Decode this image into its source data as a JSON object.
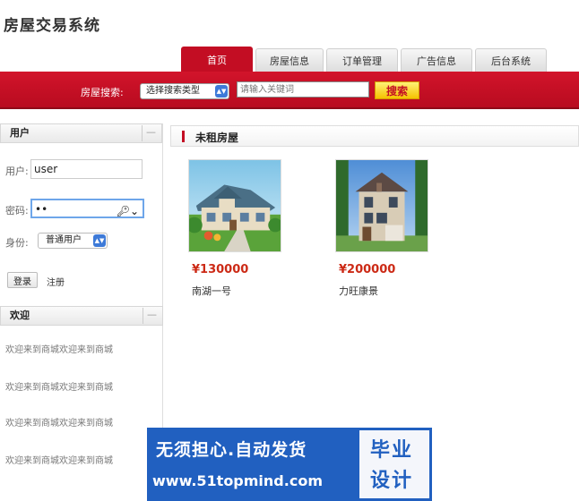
{
  "app": {
    "title": "房屋交易系统"
  },
  "nav": {
    "tabs": [
      {
        "label": "首页",
        "active": true
      },
      {
        "label": "房屋信息",
        "active": false
      },
      {
        "label": "订单管理",
        "active": false
      },
      {
        "label": "广告信息",
        "active": false
      },
      {
        "label": "后台系统",
        "active": false
      }
    ]
  },
  "search": {
    "label": "房屋搜索:",
    "type_select": "选择搜索类型",
    "placeholder": "请输入关键词",
    "button_label": "搜索"
  },
  "sidebar": {
    "user_panel": {
      "title": "用户",
      "collapse": "—",
      "username_label": "用户:",
      "username_value": "user",
      "password_label": "密码:",
      "password_value": "••",
      "role_label": "身份:",
      "role_value": "普通用户",
      "login_button": "登录",
      "register_link": "注册"
    },
    "welcome_panel": {
      "title": "欢迎",
      "collapse": "—",
      "lines": [
        "欢迎来到商城欢迎来到商城",
        "欢迎来到商城欢迎来到商城",
        "欢迎来到商城欢迎来到商城",
        "欢迎来到商城欢迎来到商城"
      ]
    }
  },
  "main": {
    "section_title": "未租房屋",
    "houses": [
      {
        "price": "¥130000",
        "name": "南湖一号",
        "image_icon": "house-photo-blue-roof"
      },
      {
        "price": "¥200000",
        "name": "力旺康景",
        "image_icon": "house-photo-townhouse"
      }
    ]
  },
  "ad": {
    "line1": "无须担心.自动发货",
    "line2": "www.51topmind.com",
    "line3": "毕业",
    "line4": "设计"
  },
  "colors": {
    "brand_red": "#c30d23",
    "price_red": "#cc2a16",
    "search_button": "#f5c200",
    "ad_blue": "#2160c0"
  }
}
